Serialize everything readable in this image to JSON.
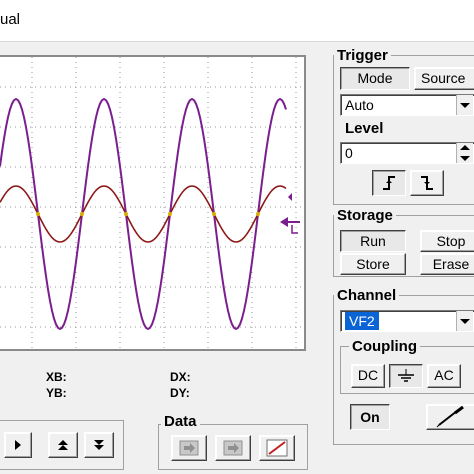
{
  "window": {
    "title": "ual"
  },
  "readouts": {
    "xb": "XB:",
    "yb": "YB:",
    "dx": "DX:",
    "dy": "DY:"
  },
  "trigger": {
    "title": "Trigger",
    "tabs": [
      "Mode",
      "Source"
    ],
    "mode_value": "Auto",
    "level_label": "Level",
    "level_value": "0"
  },
  "storage": {
    "title": "Storage",
    "buttons": [
      "Run",
      "Stop",
      "Store",
      "Erase"
    ]
  },
  "channel": {
    "title": "Channel",
    "selected": "VF2",
    "coupling_label": "Coupling",
    "coupling": [
      "DC",
      "AC"
    ],
    "on_label": "On"
  },
  "data": {
    "title": "Data"
  },
  "colors": {
    "signal_a": "#7b1f8e",
    "signal_b": "#8b1a1a",
    "selection": "#0a64d6"
  }
}
